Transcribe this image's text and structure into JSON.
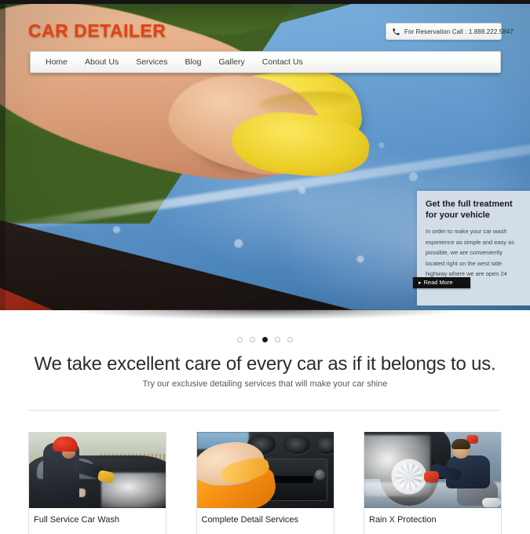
{
  "site": {
    "logo": "CAR DETAILER"
  },
  "topbar": {
    "phone_icon": "phone-icon",
    "phone_text": "For Reservation Call : 1.888.222.5847"
  },
  "nav": {
    "items": [
      {
        "label": "Home"
      },
      {
        "label": "About Us"
      },
      {
        "label": "Services"
      },
      {
        "label": "Blog"
      },
      {
        "label": "Gallery"
      },
      {
        "label": "Contact Us"
      }
    ]
  },
  "hero": {
    "image_alt": "hand with yellow sponge washing a blue car hood",
    "caption": {
      "title": "Get the full treatment for your vehicle",
      "body": "In order to make your car wash experience as simple and easy as possible, we are conveniently located right on the west side highway where we are open 24 hours a day.",
      "button_label": "Read More",
      "button_chevron": "chevron-right-icon",
      "background_color": "#d3dde7",
      "button_color": "#111111"
    }
  },
  "slider": {
    "total_dots": 5,
    "active_index": 2,
    "dots": [
      {
        "active": false
      },
      {
        "active": false
      },
      {
        "active": true
      },
      {
        "active": false
      },
      {
        "active": false
      }
    ]
  },
  "intro": {
    "headline": "We take excellent care of every car as if it belongs to us.",
    "subhead": "Try our exclusive detailing services that will make your car shine"
  },
  "services": {
    "cards": [
      {
        "label": "Full Service Car Wash",
        "image_alt": "attendant in red cap washing a foamy dark car"
      },
      {
        "label": "Complete Detail Services",
        "image_alt": "hand wiping car dashboard console with orange cloth"
      },
      {
        "label": "Rain X Protection",
        "image_alt": "man crouching to clean a foam covered car wheel"
      }
    ]
  },
  "theme": {
    "accent": "#e8400f",
    "text_dark": "#2c2c2c",
    "text_muted": "#54585c"
  }
}
